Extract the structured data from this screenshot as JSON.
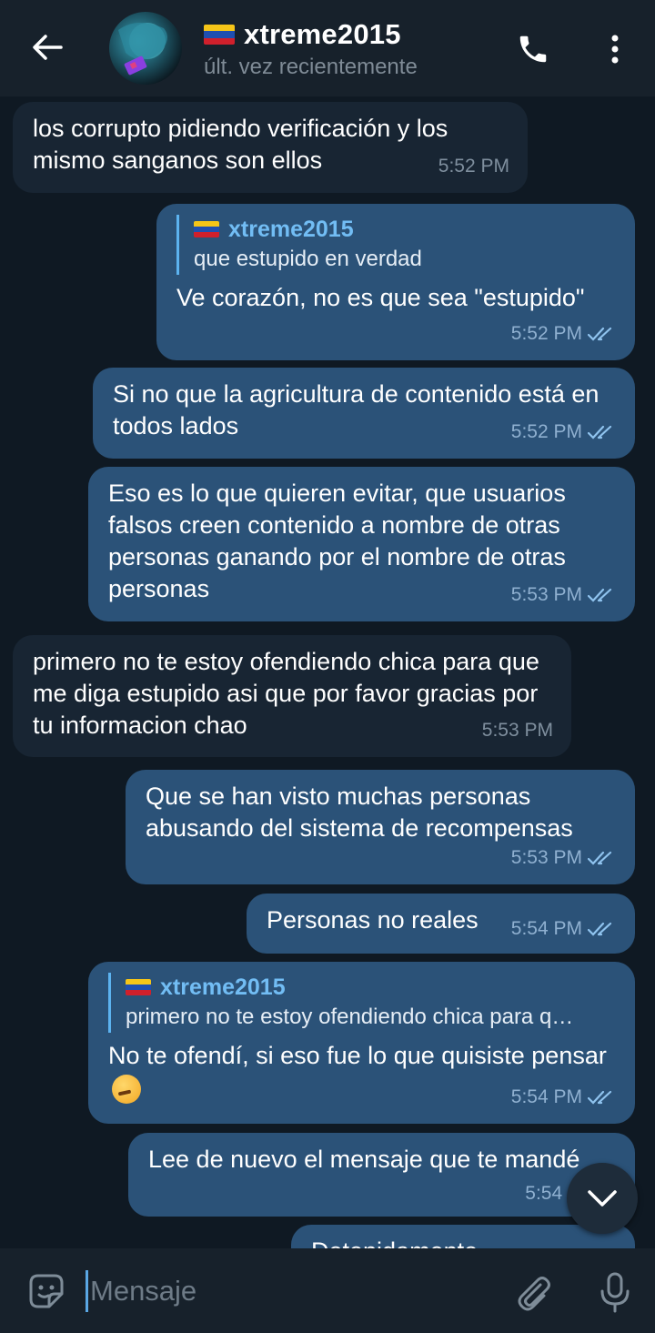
{
  "header": {
    "title": "xtreme2015",
    "status": "últ. vez recientemente",
    "avatar": "contact-avatar",
    "icons": [
      "back-arrow-icon",
      "venezuela-flag-icon",
      "phone-icon",
      "more-vert-icon"
    ]
  },
  "messages": [
    {
      "direction": "in",
      "text": "los corrupto pidiendo verificación y los mismo sanganos son ellos",
      "time": "5:52 PM"
    },
    {
      "direction": "out",
      "reply_name": "xtreme2015",
      "reply_text": "que estupido en verdad",
      "text": "Ve corazón, no es que sea \"estupido\"",
      "time": "5:52 PM"
    },
    {
      "direction": "out",
      "text": "Si no que la agricultura de contenido está en todos lados",
      "time": "5:52 PM"
    },
    {
      "direction": "out",
      "text": "Eso es lo que quieren evitar, que usuarios falsos creen contenido a nombre de otras personas ganando por el nombre de otras personas",
      "time": "5:53 PM"
    },
    {
      "direction": "in",
      "text": "primero no te estoy ofendiendo chica para que me diga estupido asi que por favor gracias por tu informacion chao",
      "time": "5:53 PM"
    },
    {
      "direction": "out",
      "text": "Que se han visto muchas personas abusando del sistema de recompensas",
      "time": "5:53 PM"
    },
    {
      "direction": "out",
      "text": "Personas no reales",
      "time": "5:54 PM"
    },
    {
      "direction": "out",
      "reply_name": "xtreme2015",
      "reply_text": "primero no te estoy ofendiendo chica para q…",
      "text": "No te ofendí, si eso fue lo que quisiste pensar",
      "emoji": "thinking-face-emoji",
      "time": "5:54 PM"
    },
    {
      "direction": "out",
      "text": "Lee de nuevo el mensaje que te mandé",
      "time": "5:54 P"
    },
    {
      "direction": "out",
      "text": "Detenidamente",
      "time": ""
    }
  ],
  "input": {
    "placeholder": "Mensaje"
  },
  "colors": {
    "header_bg": "#17212b",
    "chat_bg": "#0f1923",
    "incoming_bubble": "#182533",
    "outgoing_bubble": "#2b5278",
    "accent": "#5cb3f0"
  }
}
